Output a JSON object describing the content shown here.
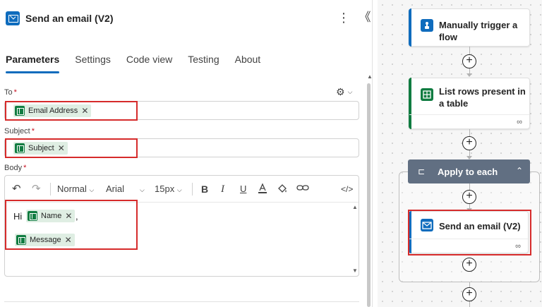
{
  "panel": {
    "title": "Send an email (V2)",
    "more_icon": "⋮",
    "collapse_icon": "《",
    "tabs": [
      "Parameters",
      "Settings",
      "Code view",
      "Testing",
      "About"
    ],
    "to": {
      "label": "To",
      "required": "*",
      "token": "Email Address"
    },
    "subject": {
      "label": "Subject",
      "required": "*",
      "token": "Subject"
    },
    "body": {
      "label": "Body",
      "required": "*",
      "toolbar": {
        "undo": "↶",
        "redo": "↷",
        "style": "Normal",
        "font": "Arial",
        "size": "15px",
        "bold": "B",
        "italic": "I",
        "underline": "U",
        "code": "</>"
      },
      "greeting": "Hi",
      "name_token": "Name",
      "comma": ",",
      "message_token": "Message"
    },
    "remove_icon": "✕"
  },
  "canvas": {
    "trigger": {
      "title": "Manually trigger a flow",
      "accent": "#0f6cbd"
    },
    "list_rows": {
      "title": "List rows present in a table",
      "accent": "#107c41"
    },
    "apply_each": {
      "title": "Apply to each",
      "accent": "#616f82"
    },
    "send_email": {
      "title": "Send an email (V2)",
      "accent": "#0f6cbd"
    },
    "add_label": "+"
  },
  "colors": {
    "highlight": "#d62b2b",
    "excel": "#107c41",
    "outlook": "#0f6cbd",
    "tab_accent": "#0f6cbd"
  }
}
